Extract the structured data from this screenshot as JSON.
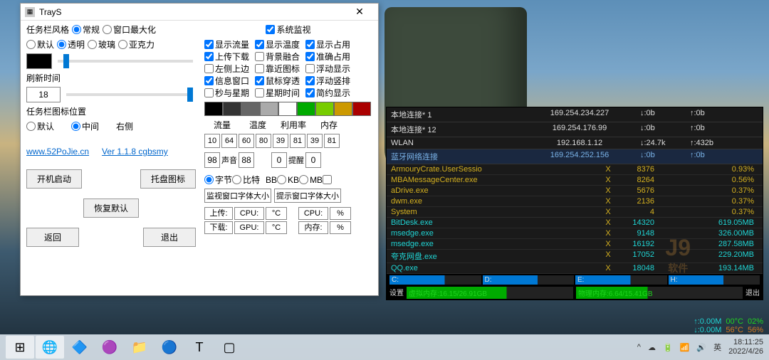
{
  "window": {
    "title": "TrayS",
    "taskbarStyle": {
      "label": "任务栏风格",
      "options": [
        "常规",
        "窗口最大化"
      ],
      "sel": 0
    },
    "transparency": {
      "options": [
        "默认",
        "透明",
        "玻璃",
        "亚克力"
      ],
      "sel": 1
    },
    "refresh": {
      "label": "刷新时间",
      "value": "18"
    },
    "iconPos": {
      "label": "任务栏图标位置",
      "options": [
        "默认",
        "中间",
        "右侧"
      ],
      "sel": 1
    },
    "links": {
      "site": "www.52PoJie.cn",
      "ver": "Ver 1.1.8 cgbsmy"
    },
    "buttons": {
      "autostart": "开机启动",
      "trayicon": "托盘图标",
      "restore": "恢复默认",
      "back": "返回",
      "exit": "退出"
    },
    "sysmon": {
      "label": "系统监视",
      "row1": [
        [
          "显示流量",
          true
        ],
        [
          "显示温度",
          true
        ],
        [
          "显示占用",
          true
        ]
      ],
      "row2": [
        [
          "上传下载",
          true
        ],
        [
          "背景融合",
          false
        ],
        [
          "准确占用",
          true
        ]
      ],
      "row3": [
        [
          "左侧上边",
          false
        ],
        [
          "靠近图标",
          false
        ],
        [
          "浮动显示",
          false
        ]
      ],
      "row4": [
        [
          "信息窗口",
          true
        ],
        [
          "鼠标穿透",
          true
        ],
        [
          "浮动竖排",
          true
        ]
      ],
      "row5": [
        [
          "秒与星期",
          false
        ],
        [
          "星期时间",
          false
        ],
        [
          "简约显示",
          true
        ]
      ]
    },
    "swatches": [
      "#000",
      "#333",
      "#666",
      "#aaa",
      "#fff",
      "#0a0",
      "#7c0",
      "#c90",
      "#a00"
    ],
    "metrics": {
      "cols": [
        "流量",
        "温度",
        "利用率",
        "内存"
      ],
      "r1": [
        "10",
        "64",
        "60",
        "80",
        "39",
        "81",
        "39",
        "81"
      ],
      "sound": "声音",
      "soundv": [
        "98",
        "88"
      ],
      "alarm": "提醒",
      "alarmv": [
        "0",
        "0"
      ]
    },
    "unit": {
      "options": [
        "字节",
        "比特"
      ],
      "sel": 0,
      "bb": "BB",
      "kb": "KB",
      "mb": "MB",
      "extra": ""
    },
    "fontlabels": [
      "监视窗口字体大小",
      "提示窗口字体大小"
    ],
    "bottom": {
      "up": "上传:",
      "dn": "下载:",
      "cpu": "CPU:",
      "gpu": "GPU:",
      "mem": "内存:",
      "c": "°C",
      "p": "%"
    }
  },
  "monitor": {
    "nets": [
      {
        "n": "本地连接* 1",
        "ip": "169.254.234.227",
        "d": "↓:0b",
        "u": "↑:0b"
      },
      {
        "n": "本地连接* 12",
        "ip": "169.254.176.99",
        "d": "↓:0b",
        "u": "↑:0b"
      },
      {
        "n": "WLAN",
        "ip": "192.168.1.12",
        "d": "↓:24.7k",
        "u": "↑:432b"
      },
      {
        "n": "蓝牙网络连接",
        "ip": "169.254.252.156",
        "d": "↓:0b",
        "u": "↑:0b",
        "blue": true
      }
    ],
    "procs": [
      {
        "n": "ArmouryCrate.UserSessio",
        "x": "X",
        "pid": "8376",
        "v": "0.93%",
        "cls": "yellow"
      },
      {
        "n": "MBAMessageCenter.exe",
        "x": "X",
        "pid": "8264",
        "v": "0.56%",
        "cls": "yellow"
      },
      {
        "n": "aDrive.exe",
        "x": "X",
        "pid": "5676",
        "v": "0.37%",
        "cls": "yellow"
      },
      {
        "n": "dwm.exe",
        "x": "X",
        "pid": "2136",
        "v": "0.37%",
        "cls": "yellow"
      },
      {
        "n": "System",
        "x": "X",
        "pid": "4",
        "v": "0.37%",
        "cls": "yellow"
      },
      {
        "n": "BitDesk.exe",
        "x": "X",
        "pid": "14320",
        "v": "619.05MB",
        "cls": "cyan"
      },
      {
        "n": "msedge.exe",
        "x": "X",
        "pid": "9148",
        "v": "326.00MB",
        "cls": "cyan"
      },
      {
        "n": "msedge.exe",
        "x": "X",
        "pid": "16192",
        "v": "287.58MB",
        "cls": "cyan"
      },
      {
        "n": "夸克网盘.exe",
        "x": "X",
        "pid": "17052",
        "v": "229.20MB",
        "cls": "cyan"
      },
      {
        "n": "QQ.exe",
        "x": "X",
        "pid": "18048",
        "v": "193.14MB",
        "cls": "cyan"
      }
    ],
    "disks": [
      "C:",
      "D:",
      "E:",
      "H:"
    ],
    "settings": "设置",
    "exit": "退出",
    "vmem": "虚拟内存:16.15/26.91GB",
    "pmem": "物理内存:6.64/15.41GB"
  },
  "tray": {
    "l1": [
      "↑:0.00M",
      "00°C",
      "02%"
    ],
    "l2": [
      "↓:0.00M",
      "56°C",
      "56%"
    ],
    "ime": "英",
    "time": "18:11:25",
    "date": "2022/4/26"
  },
  "taskbar": {
    "icons": [
      "⊞",
      "🌐",
      "🔷",
      "🟣",
      "📁",
      "🔵",
      "T",
      "▢"
    ]
  },
  "watermark": {
    "big": "J9",
    "small": "软件"
  }
}
